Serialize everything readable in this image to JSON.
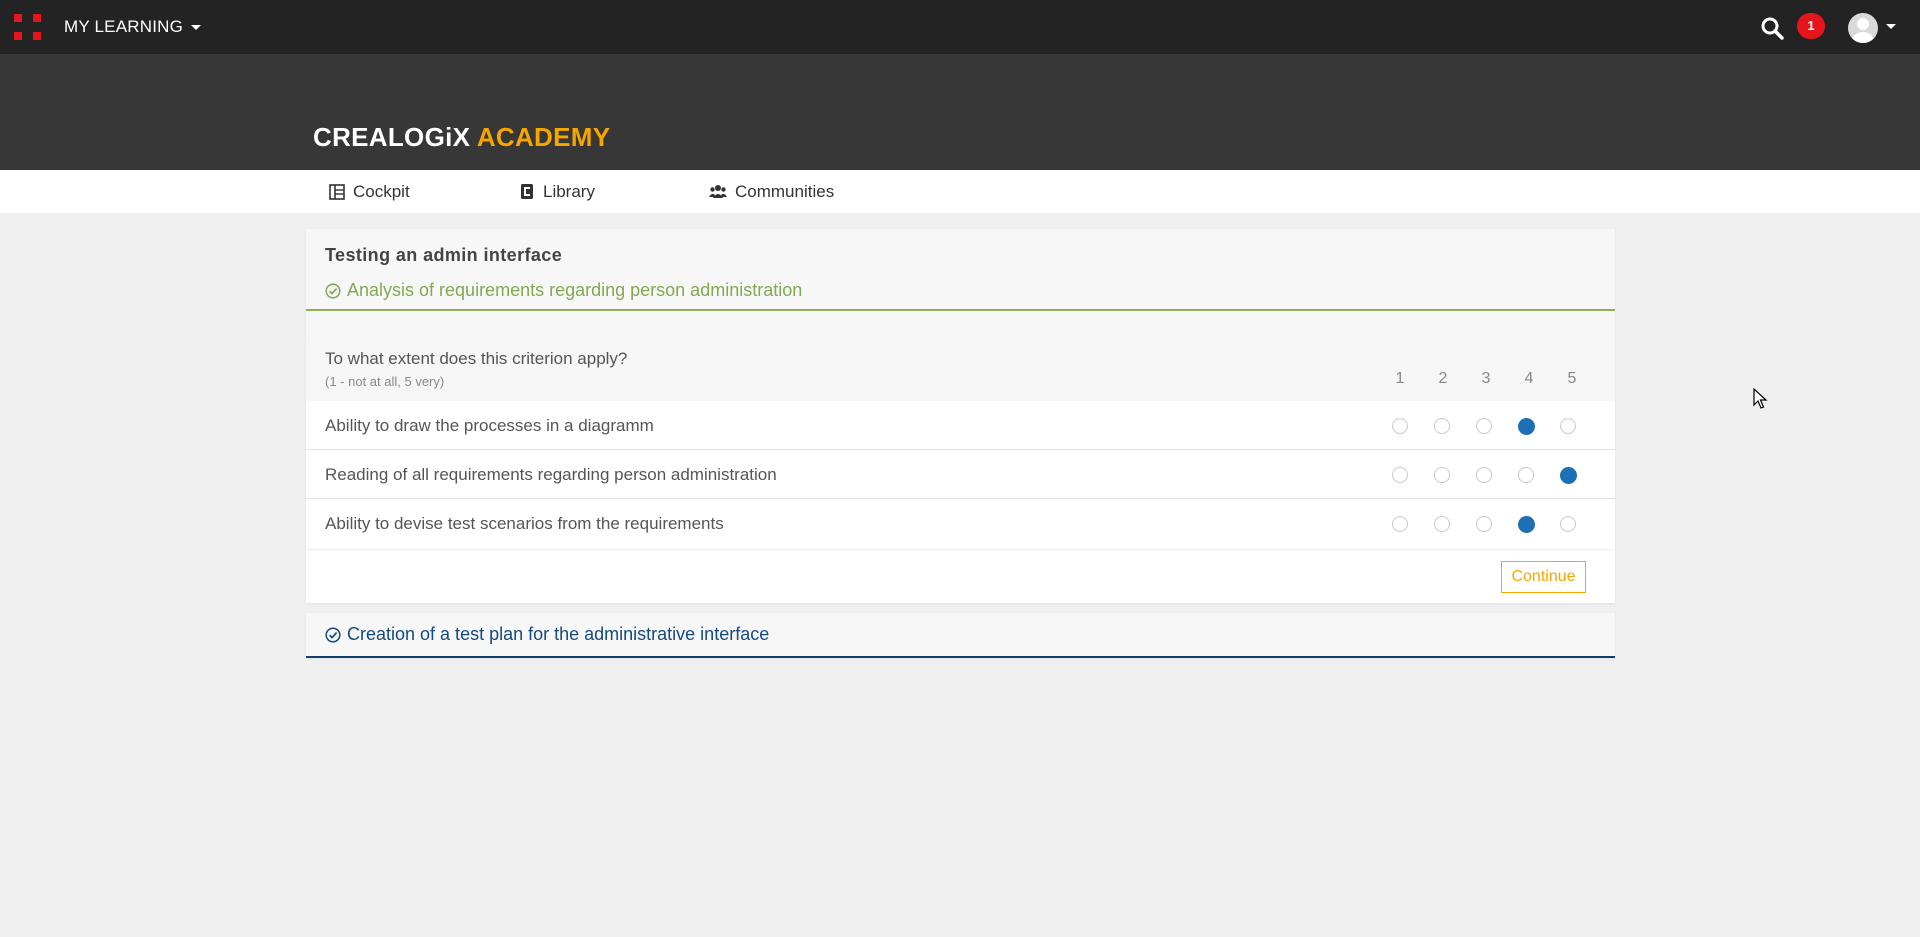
{
  "topbar": {
    "menu_title": "MY LEARNING",
    "notification_count": "1",
    "brand_red": "#e4161b"
  },
  "banner": {
    "logo_part1": "CREALOGiX",
    "logo_part2": "ACADEMY",
    "logo_accent": "#f7a600"
  },
  "nav": {
    "items": [
      {
        "label": "Cockpit",
        "icon": "cockpit-icon"
      },
      {
        "label": "Library",
        "icon": "library-icon"
      },
      {
        "label": "Communities",
        "icon": "communities-icon"
      }
    ]
  },
  "main": {
    "title": "Testing an admin interface",
    "section1": {
      "title": "Analysis of requirements regarding person administration",
      "color": "#84a950",
      "question": "To what extent does this criterion apply?",
      "hint": "(1 - not at all, 5 very)",
      "scale": [
        "1",
        "2",
        "3",
        "4",
        "5"
      ],
      "criteria": [
        {
          "label": "Ability to draw the processes in a diagramm",
          "selected": 4
        },
        {
          "label": "Reading of all requirements regarding person administration",
          "selected": 5
        },
        {
          "label": "Ability to devise test scenarios from the requirements",
          "selected": 4
        }
      ],
      "continue_label": "Continue"
    },
    "section2": {
      "title": "Creation of a test plan for the administrative interface",
      "color": "#154a80"
    }
  }
}
